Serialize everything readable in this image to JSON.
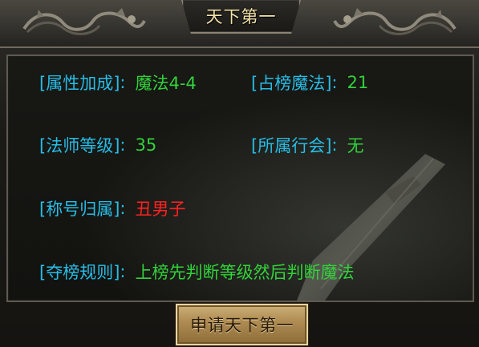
{
  "window": {
    "title": "天下第一"
  },
  "info": {
    "attribute_bonus": {
      "label": "[属性加成]",
      "colon": ":",
      "value": "魔法4-4"
    },
    "rank_magic": {
      "label": "[占榜魔法]",
      "colon": ":",
      "value": "21"
    },
    "mage_level": {
      "label": "[法师等级]",
      "colon": ":",
      "value": "35"
    },
    "guild": {
      "label": "[所属行会]",
      "colon": ":",
      "value": "无"
    },
    "title_owner": {
      "label": "[称号归属]",
      "colon": ":",
      "value": "丑男子"
    },
    "rules": {
      "label": "[夺榜规则]",
      "colon": ":",
      "value": "上榜先判断等级然后判断魔法"
    }
  },
  "actions": {
    "apply_label": "申请天下第一"
  },
  "colors": {
    "label": "#27bde6",
    "value": "#31d23a",
    "highlight": "#ff2222",
    "title": "#f2e2a8",
    "button": "#b08d54"
  },
  "icons": [
    "dragon-ornament-icon",
    "sword-background-icon"
  ]
}
